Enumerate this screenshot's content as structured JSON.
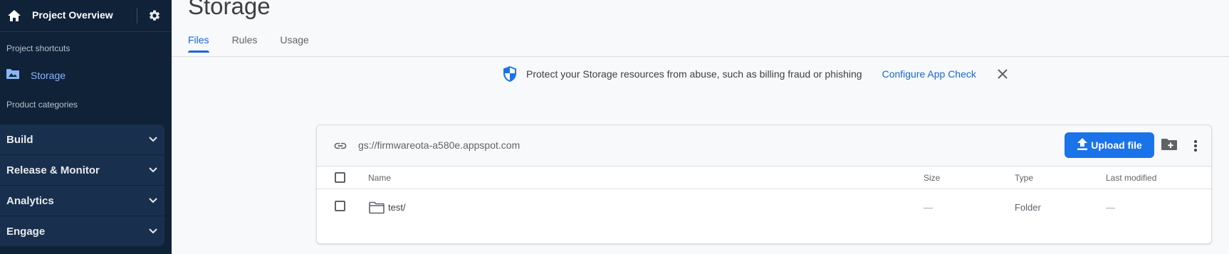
{
  "sidebar": {
    "project_title": "Project Overview",
    "shortcuts_header": "Project shortcuts",
    "storage_label": "Storage",
    "categories_header": "Product categories",
    "groups": [
      {
        "label": "Build"
      },
      {
        "label": "Release & Monitor"
      },
      {
        "label": "Analytics"
      },
      {
        "label": "Engage"
      }
    ]
  },
  "main": {
    "page_title": "Storage",
    "tabs": [
      {
        "label": "Files",
        "active": true
      },
      {
        "label": "Rules"
      },
      {
        "label": "Usage"
      }
    ],
    "banner": {
      "message": "Protect your Storage resources from abuse, such as billing fraud or phishing",
      "cta": "Configure App Check"
    },
    "bucket": "gs://firmwareota-a580e.appspot.com",
    "upload_label": "Upload file",
    "columns": {
      "name": "Name",
      "size": "Size",
      "type": "Type",
      "modified": "Last modified"
    },
    "rows": [
      {
        "name": "test/",
        "size": "—",
        "type": "Folder",
        "modified": "—"
      }
    ]
  },
  "colors": {
    "sidebar_bg": "#0f2238",
    "accent": "#1a73e8",
    "link": "#1967d2",
    "storage_active": "#8ab4f8"
  },
  "icons": [
    "home-icon",
    "gear-icon",
    "storage-folder-icon",
    "chevron-down-icon",
    "shield-icon",
    "close-icon",
    "link-icon",
    "upload-icon",
    "new-folder-icon",
    "more-vert-icon",
    "folder-icon"
  ]
}
